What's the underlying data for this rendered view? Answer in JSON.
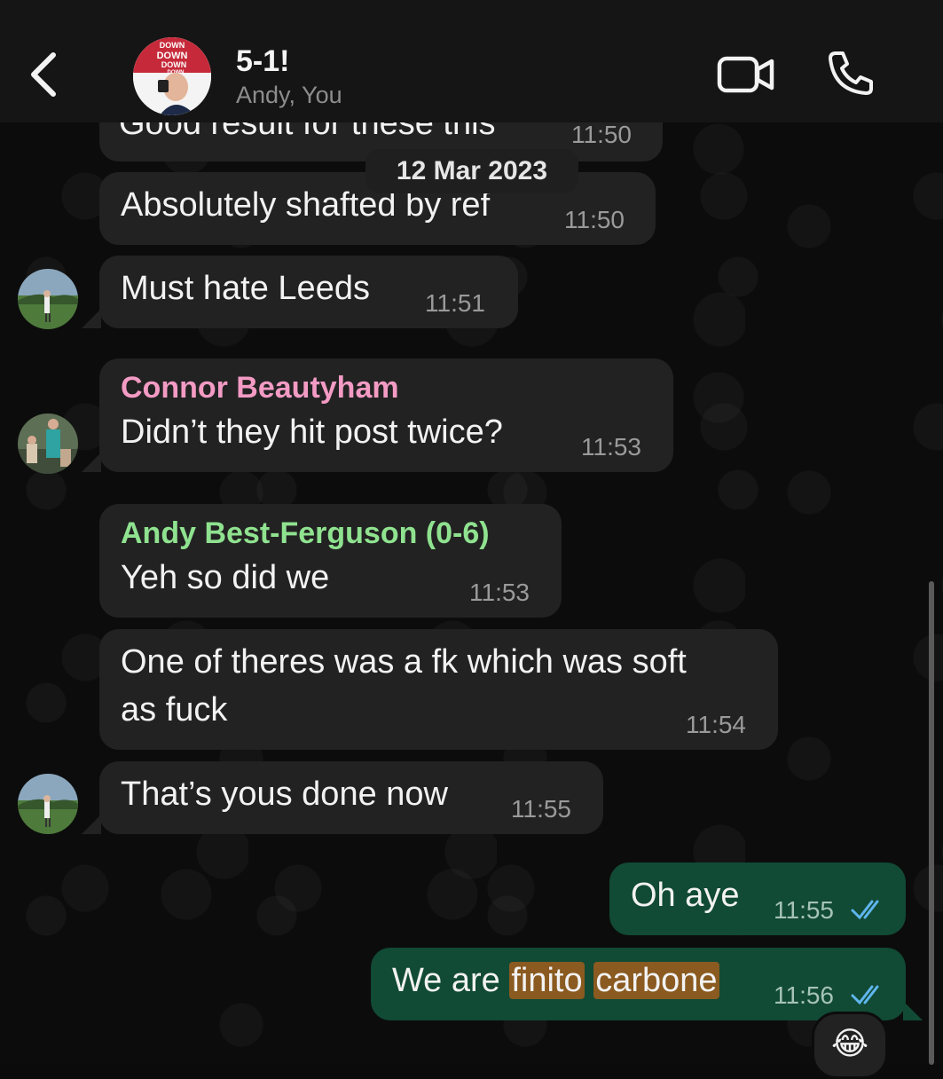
{
  "header": {
    "back_icon": "chevron-left-icon",
    "group_avatar_text": [
      "DOWN",
      "DOWN",
      "DOWN",
      "DOWN"
    ],
    "title": "5-1!",
    "subtitle": "Andy, You",
    "video_icon": "video-camera-icon",
    "call_icon": "phone-icon"
  },
  "date_chip": "12 Mar 2023",
  "messages": [
    {
      "text": "Good result for these this",
      "time": "11:50"
    },
    {
      "text": "Absolutely shafted by ref",
      "time": "11:50"
    },
    {
      "text": "Must hate Leeds",
      "time": "11:51"
    },
    {
      "sender": "Connor Beautyham",
      "text": "Didn’t they hit post twice?",
      "time": "11:53"
    },
    {
      "sender": "Andy Best-Ferguson (0-6)",
      "text": "Yeh so did we",
      "time": "11:53"
    },
    {
      "text_line1": "One of theres was a fk which was soft",
      "text_line2": "as fuck",
      "time": "11:54"
    },
    {
      "text": "That’s yous done now",
      "time": "11:55"
    },
    {
      "text": "Oh aye",
      "time": "11:55",
      "status": "read"
    },
    {
      "text_pre": "We are ",
      "hl1": "finito",
      "hl2": "carbone",
      "time": "11:56",
      "status": "read"
    }
  ],
  "reaction_emoji": "😂",
  "colors": {
    "sender_connor": "#f39bc4",
    "sender_andy": "#8fe28f",
    "outgoing_bubble": "#114a35",
    "incoming_bubble": "#222222",
    "read_ticks": "#5fb6ee"
  }
}
